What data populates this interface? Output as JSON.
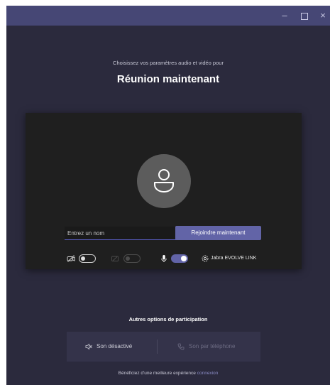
{
  "window": {
    "controls": {
      "minimize": "–",
      "close": "×"
    }
  },
  "prejoin": {
    "subtitle": "Choisissez vos paramètres audio et vidéo pour",
    "meeting_title": "Réunion maintenant",
    "name_placeholder": "Entrez un nom",
    "name_value": "",
    "join_label": "Rejoindre maintenant",
    "controls": {
      "camera_toggle": "off",
      "background_toggle": "off",
      "mic_toggle": "on",
      "device_name": "Jabra EVOLVE LINK"
    }
  },
  "other_options": {
    "title": "Autres options de participation",
    "audio_off_label": "Son désactivé",
    "phone_audio_label": "Son par téléphone"
  },
  "footer": {
    "text": "Bénéficiez d'une meilleure expérience ",
    "link": "connexion"
  },
  "colors": {
    "titlebar": "#464775",
    "background": "#2b2a3d",
    "accent": "#6264a7",
    "preview": "#1f1f1f"
  },
  "icons": [
    "camera-off-icon",
    "background-effects-icon",
    "microphone-icon",
    "device-settings-icon",
    "speaker-off-icon",
    "phone-icon",
    "person-icon"
  ]
}
